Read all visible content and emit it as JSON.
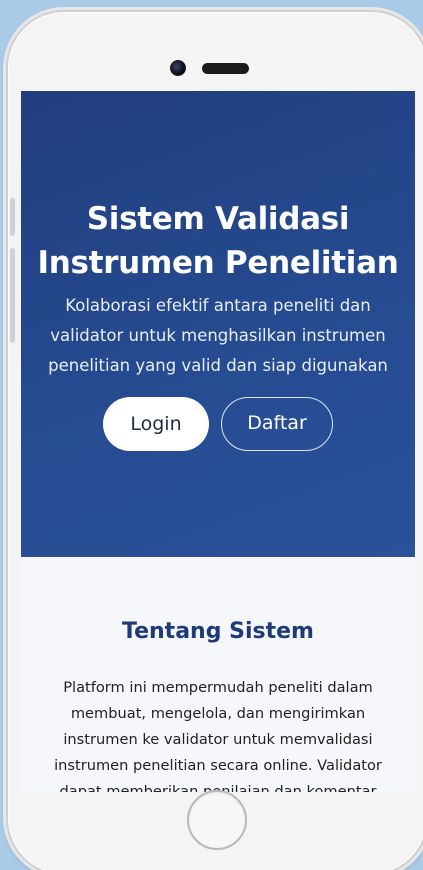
{
  "hero": {
    "title_line1": "Sistem Validasi",
    "title_line2": "Instrumen Penelitian",
    "subtitle_line1": "Kolaborasi efektif antara peneliti dan",
    "subtitle_line2": "validator untuk menghasilkan instrumen",
    "subtitle_line3": "penelitian yang valid dan siap digunakan",
    "login_label": "Login",
    "register_label": "Daftar"
  },
  "about": {
    "title": "Tentang Sistem",
    "line1": "Platform ini mempermudah peneliti dalam",
    "line2": "membuat, mengelola, dan mengirimkan",
    "line3": "instrumen ke validator untuk memvalidasi",
    "line4": "instrumen penelitian secara online. Validator",
    "line5": "dapat memberikan penilaian dan komentar"
  },
  "colors": {
    "hero_bg": "#264b91",
    "about_title": "#1f3b77",
    "page_bg": "#a9cbe8"
  }
}
